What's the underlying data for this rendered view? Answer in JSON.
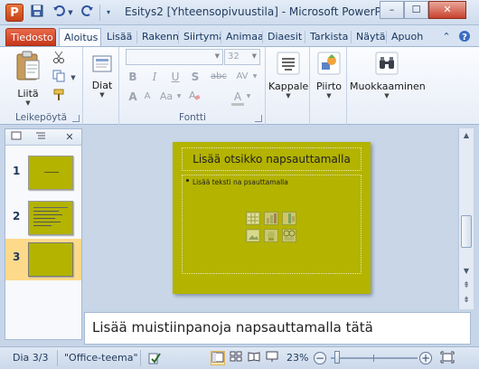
{
  "titlebar": {
    "app_icon_letter": "P",
    "title": "Esitys2 [Yhteensopivuustila] - Microsoft PowerP...",
    "window_buttons": {
      "minimize": "–",
      "maximize": "☐",
      "close": "✕"
    }
  },
  "tabs": {
    "file": "Tiedosto",
    "items": [
      "Aloitus",
      "Lisää",
      "Rakenn",
      "Siirtymä",
      "Animaa",
      "Diaesit",
      "Tarkista",
      "Näytä",
      "Apuoh"
    ],
    "active": "Aloitus"
  },
  "ribbon": {
    "clipboard": {
      "paste_label": "Liitä",
      "group_label": "Leikepöytä"
    },
    "slides": {
      "new_slide_label": "Diat"
    },
    "font": {
      "font_name": "",
      "font_size": "32",
      "group_label": "Fontti",
      "buttons": {
        "bold": "B",
        "italic": "I",
        "underline": "U",
        "strike": "abc",
        "shadow": "S",
        "spacing": "AV",
        "case": "Aa",
        "color": "A",
        "grow": "A",
        "shrink": "A"
      }
    },
    "paragraph": {
      "label": "Kappale"
    },
    "drawing": {
      "label": "Piirto"
    },
    "editing": {
      "label": "Muokkaaminen"
    }
  },
  "slides_panel": {
    "slides": [
      {
        "number": "1"
      },
      {
        "number": "2"
      },
      {
        "number": "3",
        "selected": true
      }
    ]
  },
  "slide": {
    "title_placeholder": "Lisää otsikko napsauttamalla",
    "body_placeholder": "Lisää teksti na psauttamalla",
    "background_color": "#b3b300"
  },
  "notes": {
    "placeholder": "Lisää muistiinpanoja napsauttamalla tätä"
  },
  "statusbar": {
    "slide_info": "Dia 3/3",
    "theme": "\"Office-teema\"",
    "zoom": "23%",
    "zoom_percent": 23
  },
  "colors": {
    "accent_file_tab": "#c7361b",
    "slide_background": "#b3b300",
    "selected_thumb": "#fdd98a"
  }
}
